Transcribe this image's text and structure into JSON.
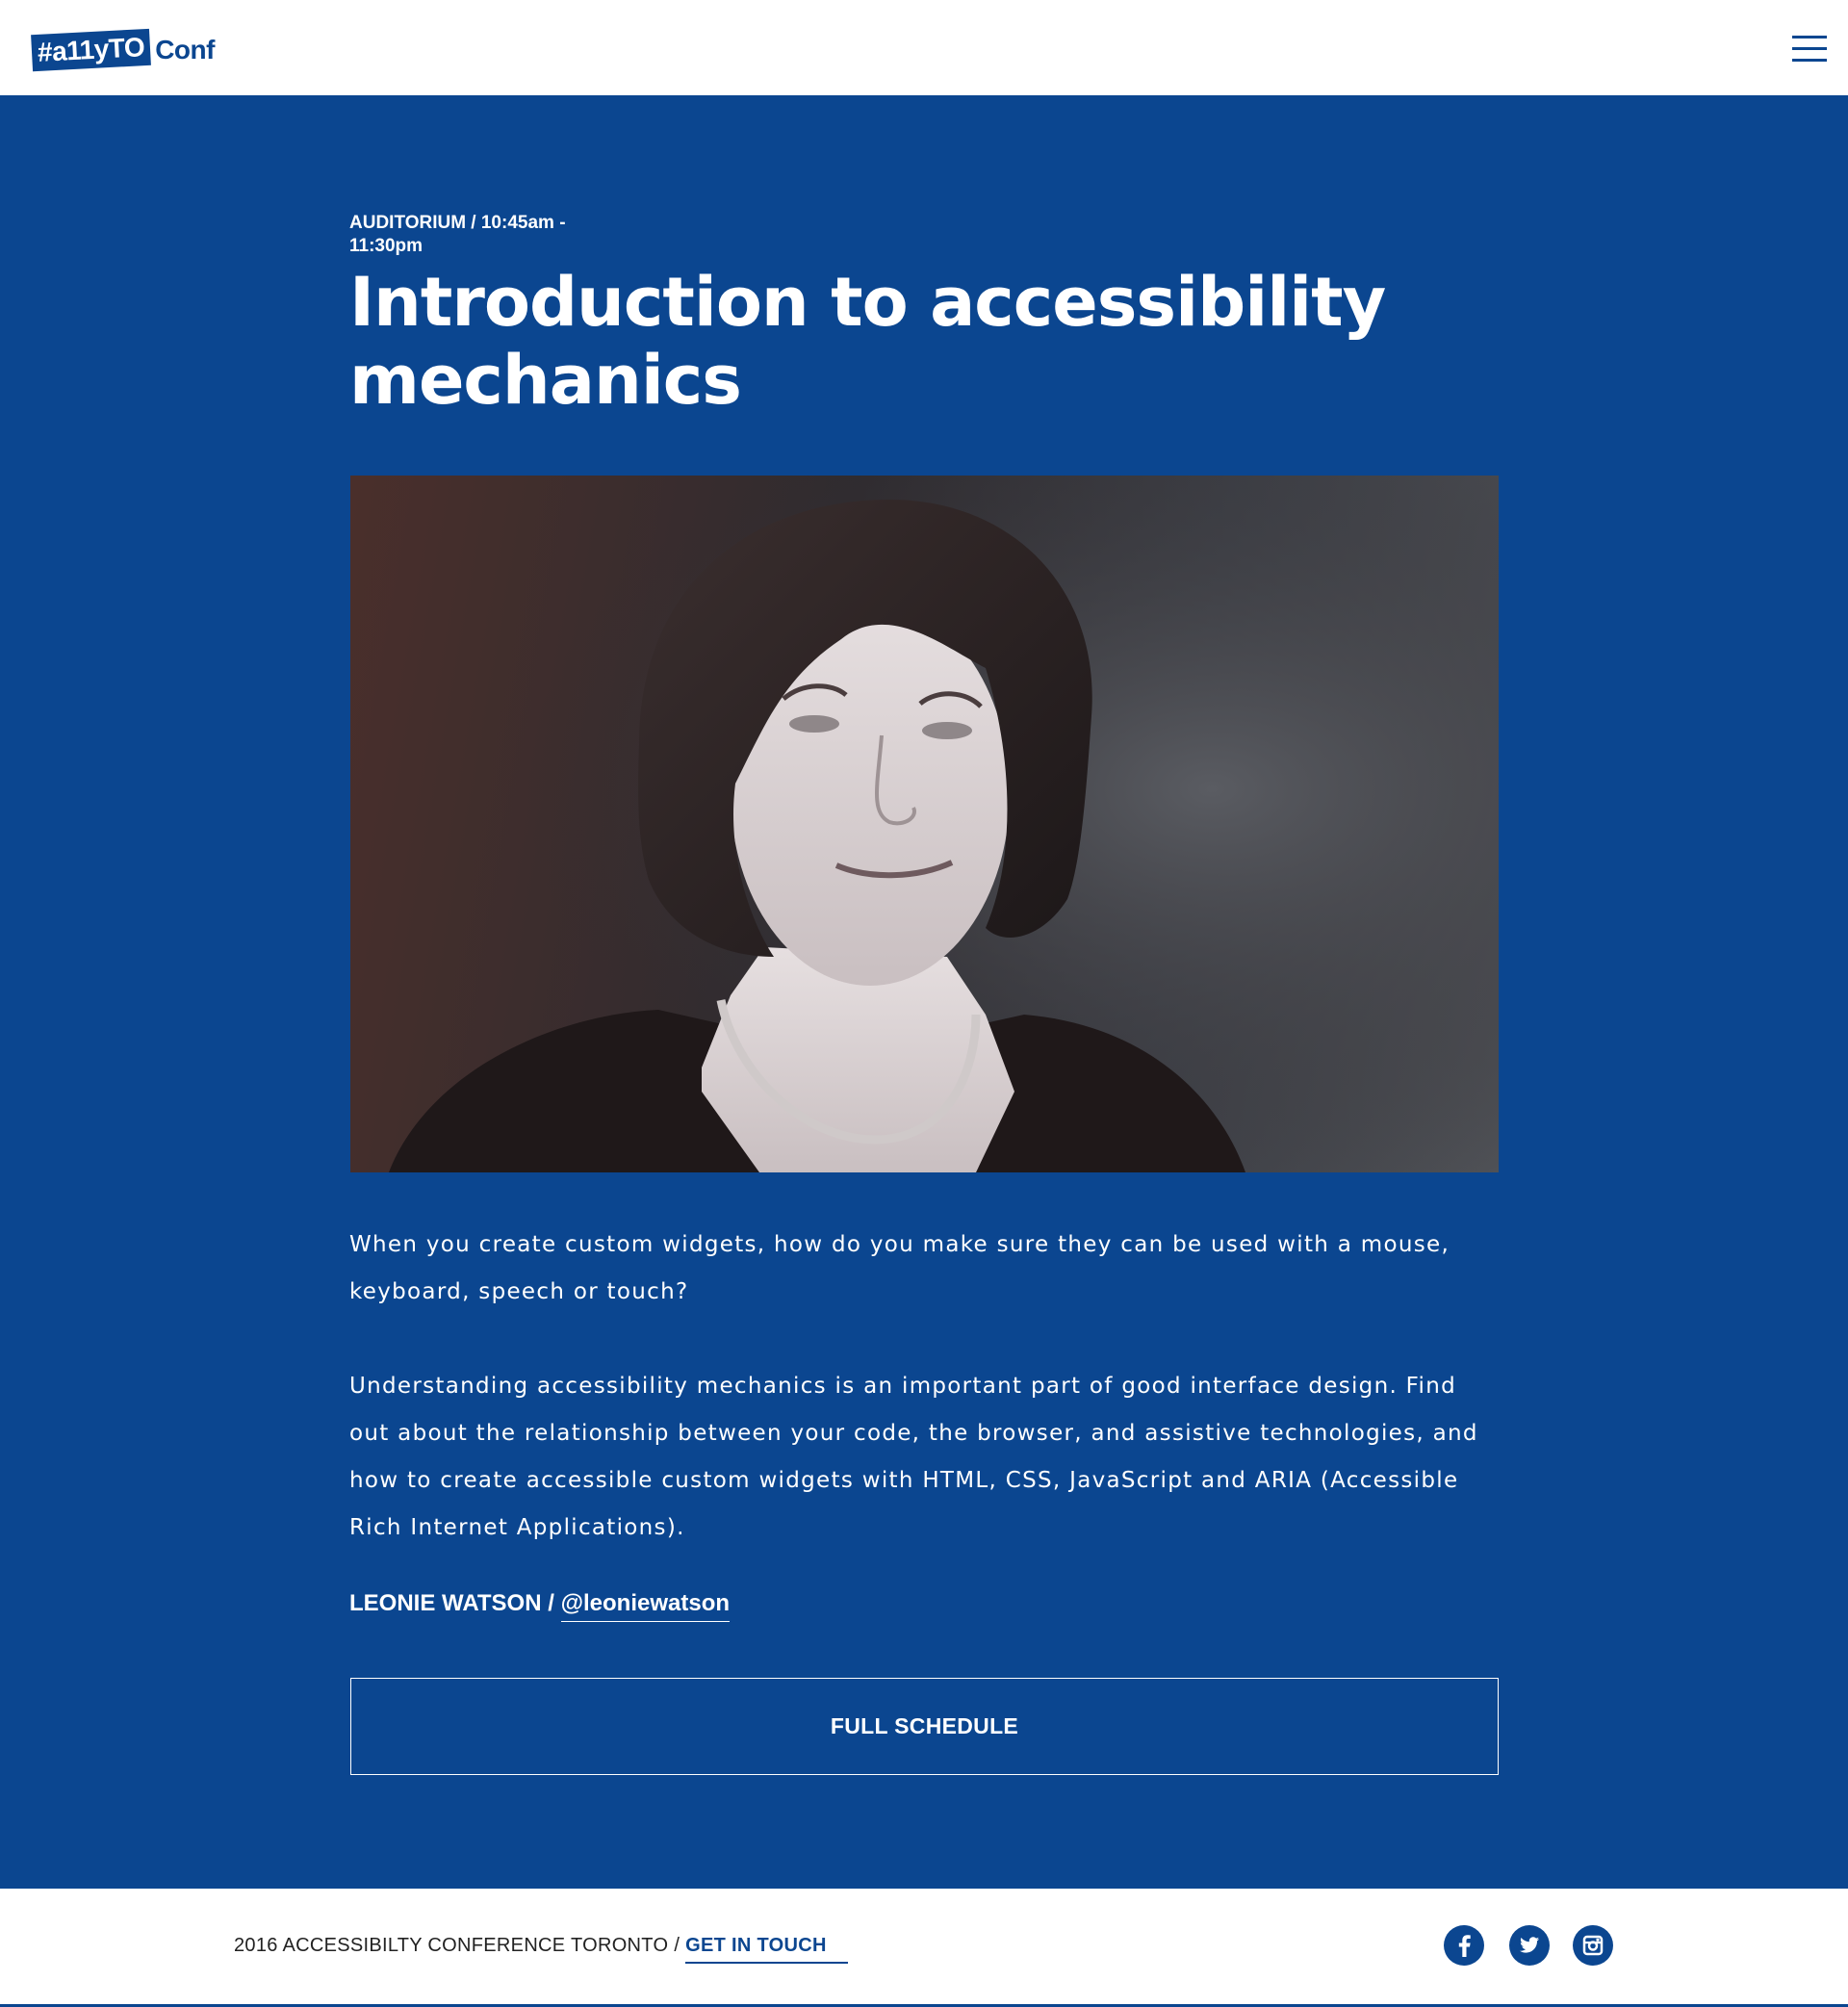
{
  "header": {
    "logo_box_text": "#a11yTO",
    "logo_text": "Conf",
    "menu_label": "Menu"
  },
  "session": {
    "meta": "AUDITORIUM / 10:45am - 11:30pm",
    "title": "Introduction to accessibility mechanics",
    "photo_alt": "Leonie Watson",
    "description": [
      "When you create custom widgets, how do you make sure they can be used with a mouse, keyboard, speech or touch?",
      "Understanding accessibility mechanics is an important part of good interface design. Find out about the relationship between your code, the browser, and assistive technologies, and how to create accessible custom widgets with HTML, CSS, JavaScript and ARIA (Accessible Rich Internet Applications)."
    ],
    "speaker_name": "LEONIE WATSON /",
    "speaker_handle": "@leoniewatson",
    "full_schedule_label": "FULL SCHEDULE"
  },
  "footer": {
    "text": "2016 ACCESSIBILTY CONFERENCE TORONTO",
    "separator": "/",
    "contact_link": "GET IN TOUCH",
    "social": [
      {
        "icon": "facebook-icon"
      },
      {
        "icon": "twitter-icon"
      },
      {
        "icon": "instagram-icon"
      }
    ]
  },
  "colors": {
    "brand_blue": "#0b4690",
    "white": "#ffffff",
    "footer_text": "#222222"
  }
}
